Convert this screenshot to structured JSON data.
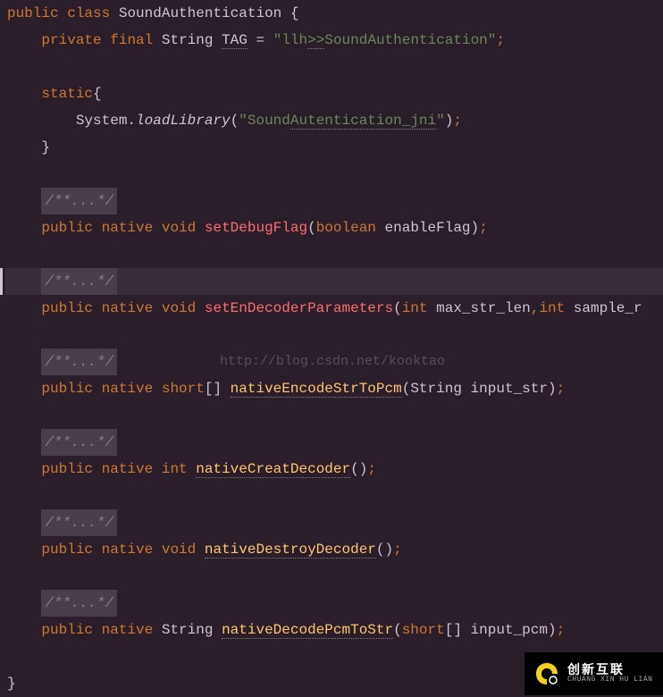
{
  "code": {
    "l1_public": "public",
    "l1_class": "class",
    "l1_name": "SoundAuthentication",
    "l1_brace": "{",
    "l2_private": "private",
    "l2_final": "final",
    "l2_type": "String",
    "l2_var": "TAG",
    "l2_eq": "=",
    "l2_q1": "\"",
    "l2_s1": "llh",
    "l2_s2": ">>",
    "l2_s3": "SoundAuthentication",
    "l2_q2": "\"",
    "l2_semi": ";",
    "l3_static": "static",
    "l3_brace": "{",
    "l4_sys": "System.",
    "l4_method": "loadLibrary",
    "l4_p1": "(",
    "l4_q1": "\"",
    "l4_s1": "Sound",
    "l4_s2": "Autentication_jni",
    "l4_q2": "\"",
    "l4_p2": ")",
    "l4_semi": ";",
    "l5_brace": "}",
    "cblock": "/**...*/",
    "m1_public": "public",
    "m1_native": "native",
    "m1_void": "void",
    "m1_name": "setDebugFlag",
    "m1_p1": "(",
    "m1_ptype": "boolean",
    "m1_pname": "enableFlag",
    "m1_p2": ")",
    "m1_semi": ";",
    "m2_public": "public",
    "m2_native": "native",
    "m2_void": "void",
    "m2_name": "setEnDecoderParameters",
    "m2_p1": "(",
    "m2_ptype1": "int",
    "m2_pname1": "max_str_len",
    "m2_comma": ",",
    "m2_ptype2": "int",
    "m2_pname2": "sample_r",
    "watermark": "http://blog.csdn.net/kooktao",
    "m3_public": "public",
    "m3_native": "native",
    "m3_ret": "short",
    "m3_br": "[]",
    "m3_name": "nativeEncodeStrToPcm",
    "m3_p1": "(",
    "m3_ptype": "String",
    "m3_pname": "input_str",
    "m3_p2": ")",
    "m3_semi": ";",
    "m4_public": "public",
    "m4_native": "native",
    "m4_ret": "int",
    "m4_name": "nativeCreatDecoder",
    "m4_p1": "(",
    "m4_p2": ")",
    "m4_semi": ";",
    "m5_public": "public",
    "m5_native": "native",
    "m5_void": "void",
    "m5_name": "nativeDestroyDecoder",
    "m5_p1": "(",
    "m5_p2": ")",
    "m5_semi": ";",
    "m6_public": "public",
    "m6_native": "native",
    "m6_ret": "String",
    "m6_name": "nativeDecodePcmToStr",
    "m6_p1": "(",
    "m6_ptype": "short",
    "m6_br": "[]",
    "m6_pname": "input_pcm",
    "m6_p2": ")",
    "m6_semi": ";",
    "end_brace": "}"
  },
  "badge": {
    "cn": "创新互联",
    "en": "CHUANG XIN HU LIAN"
  }
}
